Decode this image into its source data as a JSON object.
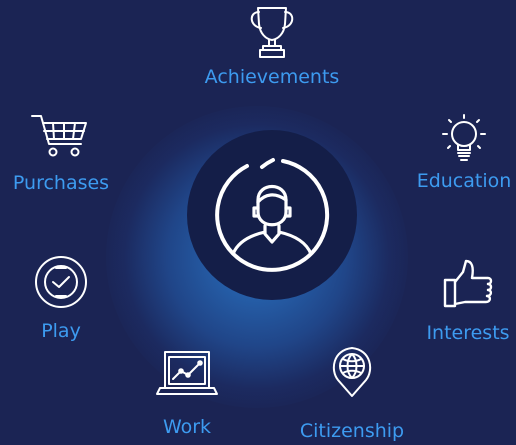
{
  "colors": {
    "background": "#1b2454",
    "hub": "#141e48",
    "accent": "#3d9bf0",
    "icon_stroke": "#ffffff"
  },
  "center": {
    "icon": "user-profile-icon"
  },
  "categories": [
    {
      "key": "achievements",
      "label": "Achievements",
      "icon": "trophy-icon"
    },
    {
      "key": "education",
      "label": "Education",
      "icon": "lightbulb-icon"
    },
    {
      "key": "interests",
      "label": "Interests",
      "icon": "thumbs-up-icon"
    },
    {
      "key": "citizenship",
      "label": "Citizenship",
      "icon": "map-pin-globe-icon"
    },
    {
      "key": "work",
      "label": "Work",
      "icon": "laptop-chart-icon"
    },
    {
      "key": "play",
      "label": "Play",
      "icon": "game-badge-icon"
    },
    {
      "key": "purchases",
      "label": "Purchases",
      "icon": "shopping-cart-icon"
    }
  ]
}
